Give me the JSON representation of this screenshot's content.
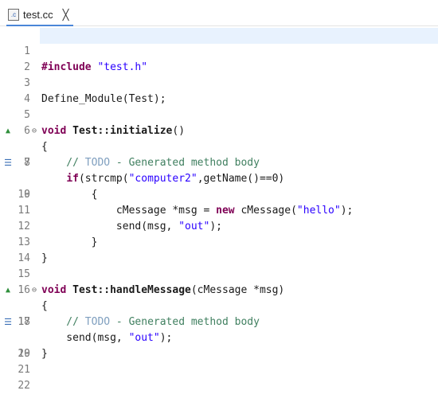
{
  "tab": {
    "icon_text": ".c",
    "label": "test.cc",
    "close_glyph": "╳"
  },
  "gutter": {
    "fold_glyph": "⊖",
    "override_glyph": "▲",
    "task_glyph": "☰"
  },
  "lines": [
    {
      "num": "1"
    },
    {
      "num": "2"
    },
    {
      "num": "3",
      "p1": "#include ",
      "s1": "\"test.h\""
    },
    {
      "num": "4"
    },
    {
      "num": "5",
      "p1": "Define_Module(Test);"
    },
    {
      "num": "6"
    },
    {
      "num": "7",
      "k1": "void ",
      "b1": "Test::initialize",
      "p1": "()"
    },
    {
      "num": "8",
      "p1": "{"
    },
    {
      "num": "9",
      "c1": "    // ",
      "t1": "TODO",
      "c2": " - Generated method body"
    },
    {
      "num": "10",
      "p1": "    ",
      "k1": "if",
      "p2": "(strcmp(",
      "s1": "\"computer2\"",
      "p3": ",getName()==0)"
    },
    {
      "num": "11",
      "p1": "        {"
    },
    {
      "num": "12",
      "p1": "            cMessage *msg = ",
      "k1": "new",
      "p2": " cMessage(",
      "s1": "\"hello\"",
      "p3": ");"
    },
    {
      "num": "13",
      "p1": "            send(msg, ",
      "s1": "\"out\"",
      "p2": ");"
    },
    {
      "num": "14",
      "p1": "        }"
    },
    {
      "num": "15",
      "p1": "}"
    },
    {
      "num": "16"
    },
    {
      "num": "17",
      "k1": "void ",
      "b1": "Test::handleMessage",
      "p1": "(cMessage *msg)"
    },
    {
      "num": "18",
      "p1": "{"
    },
    {
      "num": "19",
      "c1": "    // ",
      "t1": "TODO",
      "c2": " - Generated method body"
    },
    {
      "num": "20",
      "p1": "    send(msg, ",
      "s1": "\"out\"",
      "p2": ");"
    },
    {
      "num": "21",
      "p1": "}"
    },
    {
      "num": "22"
    }
  ]
}
